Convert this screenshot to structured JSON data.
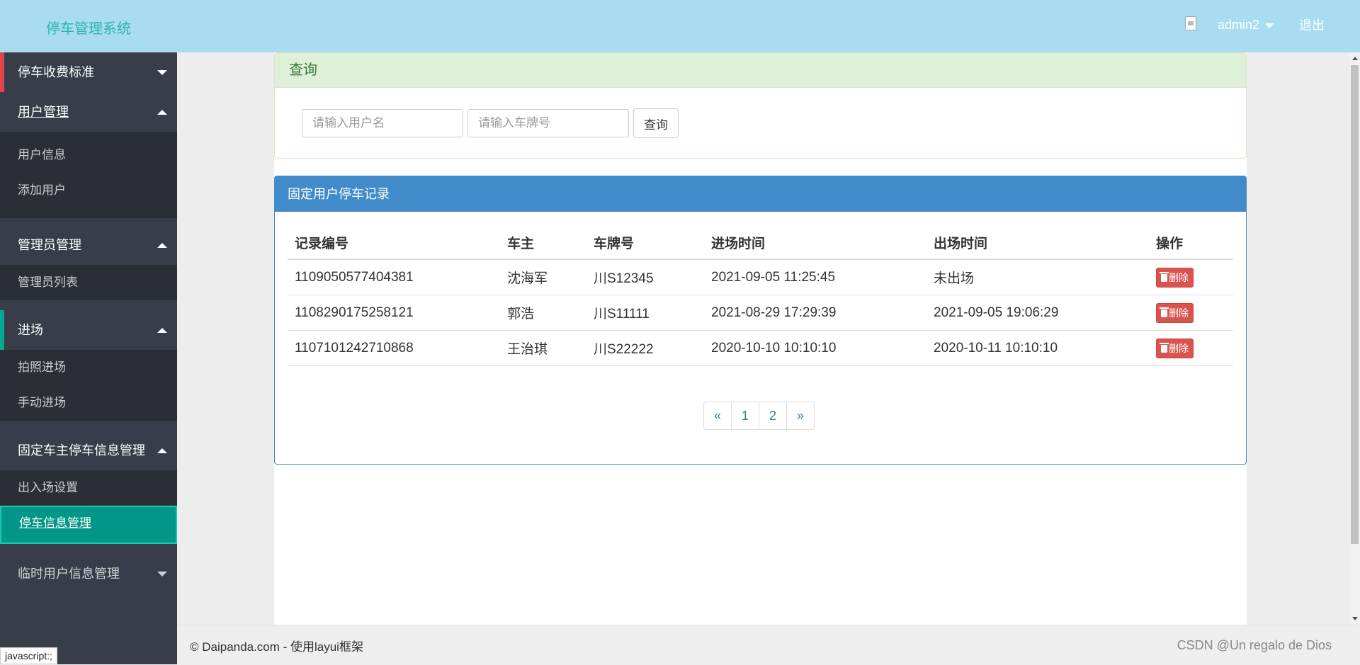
{
  "header": {
    "logo": "停车管理系统",
    "username": "admin2",
    "logout": "退出"
  },
  "sidebar": {
    "groups": [
      {
        "label": "停车收费标准",
        "expanded": false,
        "items": []
      },
      {
        "label": "用户管理",
        "expanded": true,
        "items": [
          "用户信息",
          "添加用户"
        ]
      },
      {
        "label": "管理员管理",
        "expanded": true,
        "items": [
          "管理员列表"
        ]
      },
      {
        "label": "进场",
        "expanded": true,
        "items": [
          "拍照进场",
          "手动进场"
        ]
      },
      {
        "label": "固定车主停车信息管理",
        "expanded": true,
        "items": [
          "出入场设置",
          "停车信息管理"
        ]
      },
      {
        "label": "临时用户信息管理",
        "expanded": false,
        "items": []
      }
    ],
    "active_item": "停车信息管理",
    "accent_colors": {
      "first": "#e2434a",
      "third": "#00a88f"
    }
  },
  "query": {
    "title": "查询",
    "username_placeholder": "请输入用户名",
    "plate_placeholder": "请输入车牌号",
    "button": "查询"
  },
  "records": {
    "title": "固定用户停车记录",
    "columns": [
      "记录编号",
      "车主",
      "车牌号",
      "进场时间",
      "出场时间",
      "操作"
    ],
    "rows": [
      {
        "id": "1109050577404381",
        "owner": "沈海军",
        "plate": "川S12345",
        "in": "2021-09-05 11:25:45",
        "out": "未出场",
        "action": "删除"
      },
      {
        "id": "1108290175258121",
        "owner": "郭浩",
        "plate": "川S11111",
        "in": "2021-08-29 17:29:39",
        "out": "2021-09-05 19:06:29",
        "action": "删除"
      },
      {
        "id": "1107101242710868",
        "owner": "王治琪",
        "plate": "川S22222",
        "in": "2020-10-10 10:10:10",
        "out": "2020-10-11 10:10:10",
        "action": "删除"
      }
    ],
    "pagination": [
      "«",
      "1",
      "2",
      "»"
    ]
  },
  "footer": {
    "copyright": "© Daipanda.com - 使用layui框架",
    "watermark": "CSDN @Un regalo de Dios"
  },
  "status_url": "javascript:;"
}
